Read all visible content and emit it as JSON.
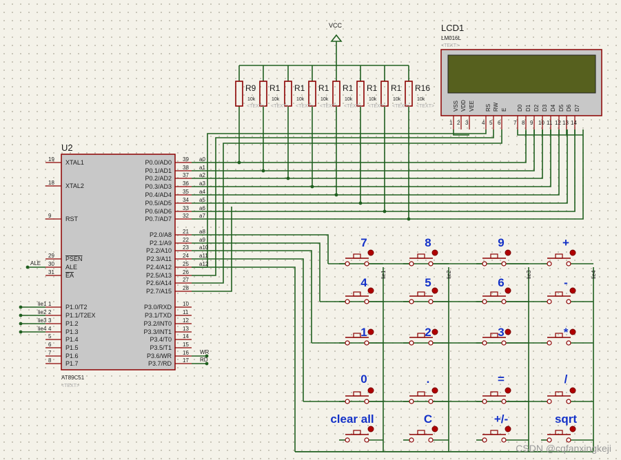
{
  "vcc": {
    "label": "VCC"
  },
  "lcd": {
    "ref": "LCD1",
    "model": "LM016L",
    "text_placeholder": "<TEXT>",
    "pins": [
      {
        "name": "VSS",
        "num": "1"
      },
      {
        "name": "VDD",
        "num": "2"
      },
      {
        "name": "VEE",
        "num": "3"
      },
      {
        "name": "RS",
        "num": "4"
      },
      {
        "name": "RW",
        "num": "5"
      },
      {
        "name": "E",
        "num": "6"
      },
      {
        "name": "D0",
        "num": "7"
      },
      {
        "name": "D1",
        "num": "8"
      },
      {
        "name": "D2",
        "num": "9"
      },
      {
        "name": "D3",
        "num": "10"
      },
      {
        "name": "D4",
        "num": "11"
      },
      {
        "name": "D5",
        "num": "12"
      },
      {
        "name": "D6",
        "num": "13"
      },
      {
        "name": "D7",
        "num": "14"
      }
    ]
  },
  "resistors": [
    {
      "ref": "R9",
      "value": "10k"
    },
    {
      "ref": "R1",
      "value": "10k"
    },
    {
      "ref": "R1",
      "value": "10k"
    },
    {
      "ref": "R1",
      "value": "10k"
    },
    {
      "ref": "R1",
      "value": "10k"
    },
    {
      "ref": "R1",
      "value": "10k"
    },
    {
      "ref": "R1",
      "value": "10k"
    },
    {
      "ref": "R16",
      "value": "10k"
    }
  ],
  "resistor_text_placeholder": "<TEXT>",
  "mcu": {
    "ref": "U2",
    "model": "AT89C51",
    "text_placeholder": "<TEXT>",
    "left_pins": [
      {
        "num": "19",
        "name": "XTAL1"
      },
      {
        "num": "18",
        "name": "XTAL2"
      },
      {
        "num": "9",
        "name": "RST"
      },
      {
        "num": "29",
        "name": "PSEN"
      },
      {
        "num": "30",
        "name": "ALE"
      },
      {
        "num": "31",
        "name": "EA"
      },
      {
        "num": "1",
        "name": "P1.0/T2"
      },
      {
        "num": "2",
        "name": "P1.1/T2EX"
      },
      {
        "num": "3",
        "name": "P1.2"
      },
      {
        "num": "4",
        "name": "P1.3"
      },
      {
        "num": "5",
        "name": "P1.4"
      },
      {
        "num": "6",
        "name": "P1.5"
      },
      {
        "num": "7",
        "name": "P1.6"
      },
      {
        "num": "8",
        "name": "P1.7"
      }
    ],
    "right_pins": [
      {
        "num": "39",
        "name": "P0.0/AD0"
      },
      {
        "num": "38",
        "name": "P0.1/AD1"
      },
      {
        "num": "37",
        "name": "P0.2/AD2"
      },
      {
        "num": "36",
        "name": "P0.3/AD3"
      },
      {
        "num": "35",
        "name": "P0.4/AD4"
      },
      {
        "num": "34",
        "name": "P0.5/AD5"
      },
      {
        "num": "33",
        "name": "P0.6/AD6"
      },
      {
        "num": "32",
        "name": "P0.7/AD7"
      },
      {
        "num": "21",
        "name": "P2.0/A8"
      },
      {
        "num": "22",
        "name": "P2.1/A9"
      },
      {
        "num": "23",
        "name": "P2.2/A10"
      },
      {
        "num": "24",
        "name": "P2.3/A11"
      },
      {
        "num": "25",
        "name": "P2.4/A12"
      },
      {
        "num": "26",
        "name": "P2.5/A13"
      },
      {
        "num": "27",
        "name": "P2.6/A14"
      },
      {
        "num": "28",
        "name": "P2.7/A15"
      },
      {
        "num": "10",
        "name": "P3.0/RXD"
      },
      {
        "num": "11",
        "name": "P3.1/TXD"
      },
      {
        "num": "12",
        "name": "P3.2/INT0"
      },
      {
        "num": "13",
        "name": "P3.3/INT1"
      },
      {
        "num": "14",
        "name": "P3.4/T0"
      },
      {
        "num": "15",
        "name": "P3.5/T1"
      },
      {
        "num": "16",
        "name": "P3.6/WR"
      },
      {
        "num": "17",
        "name": "P3.7/RD"
      }
    ]
  },
  "nets": {
    "p0": [
      "a0",
      "a1",
      "a2",
      "a3",
      "a4",
      "a5",
      "a6",
      "a7"
    ],
    "p2": [
      "a8",
      "a9",
      "a10",
      "a11",
      "a12"
    ],
    "p1": [
      "lie1",
      "lie2",
      "lie3",
      "lie4"
    ],
    "ale": "ALE",
    "wr": "WR",
    "rd": "RD",
    "columns": [
      "lie1",
      "lie2",
      "lie3",
      "lie4"
    ]
  },
  "keys": [
    [
      "7",
      "8",
      "9",
      "+"
    ],
    [
      "4",
      "5",
      "6",
      "-"
    ],
    [
      "1",
      "2",
      "3",
      "*"
    ],
    [
      "0",
      ".",
      "=",
      "/"
    ],
    [
      "clear all",
      "C",
      "+/-",
      "sqrt"
    ]
  ],
  "colors": {
    "wire": "#1f5f1f",
    "outline": "#8b0000",
    "ic_fill": "#c8c8c8",
    "lcd_screen": "#56601e",
    "key_text": "#1432c8"
  },
  "watermark": "CSDN @cqfanxingkeji"
}
